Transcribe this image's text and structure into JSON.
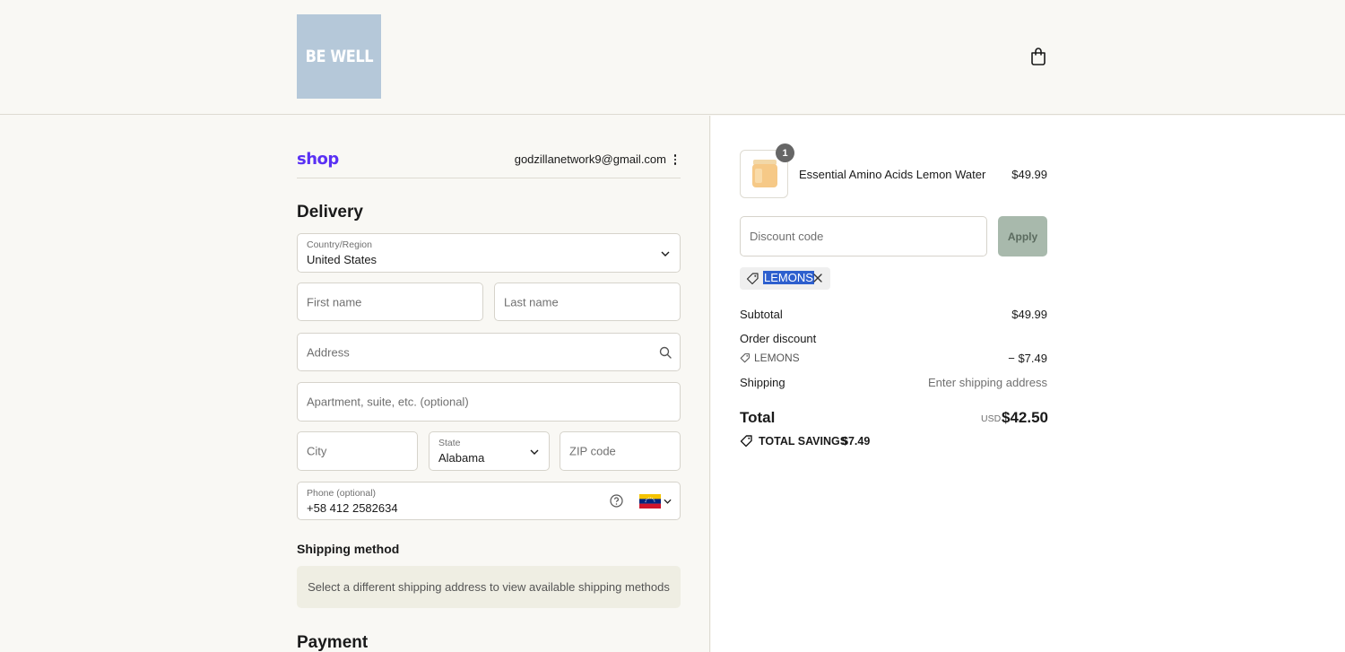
{
  "header": {
    "logo_text": "BE WELL",
    "cart_icon": "shopping-bag-icon"
  },
  "account": {
    "shop_logo": "shop",
    "email": "godzillanetwork9@gmail.com",
    "menu_icon": "kebab-menu-icon"
  },
  "delivery": {
    "title": "Delivery",
    "country": {
      "label": "Country/Region",
      "value": "United States"
    },
    "first_name": {
      "placeholder": "First name"
    },
    "last_name": {
      "placeholder": "Last name"
    },
    "address": {
      "placeholder": "Address"
    },
    "apartment": {
      "placeholder": "Apartment, suite, etc. (optional)"
    },
    "city": {
      "placeholder": "City"
    },
    "state": {
      "label": "State",
      "value": "Alabama"
    },
    "zip": {
      "placeholder": "ZIP code"
    },
    "phone": {
      "label": "Phone (optional)",
      "value": "+58 412 2582634",
      "flag": "Venezuela"
    }
  },
  "shipping_method": {
    "title": "Shipping method",
    "notice": "Select a different shipping address to view available shipping methods"
  },
  "payment": {
    "title": "Payment"
  },
  "summary": {
    "item": {
      "quantity": "1",
      "name": "Essential Amino Acids Lemon Water",
      "price": "$49.99"
    },
    "discount": {
      "placeholder": "Discount code",
      "apply_label": "Apply",
      "applied_code": "LEMONS"
    },
    "subtotal_label": "Subtotal",
    "subtotal_value": "$49.99",
    "order_discount_label": "Order discount",
    "order_discount_code": "LEMONS",
    "order_discount_value": "− $7.49",
    "shipping_label": "Shipping",
    "shipping_value": "Enter shipping address",
    "total_label": "Total",
    "total_currency": "USD",
    "total_value": "$42.50",
    "savings_label": "TOTAL SAVINGS",
    "savings_value": "$7.49"
  },
  "colors": {
    "page_bg": "#f9f8f4",
    "logo_bg": "#b5c8d9",
    "shop_purple": "#5a31f4",
    "apply_bg": "#a8b9ac",
    "selection": "#2d5fce"
  }
}
